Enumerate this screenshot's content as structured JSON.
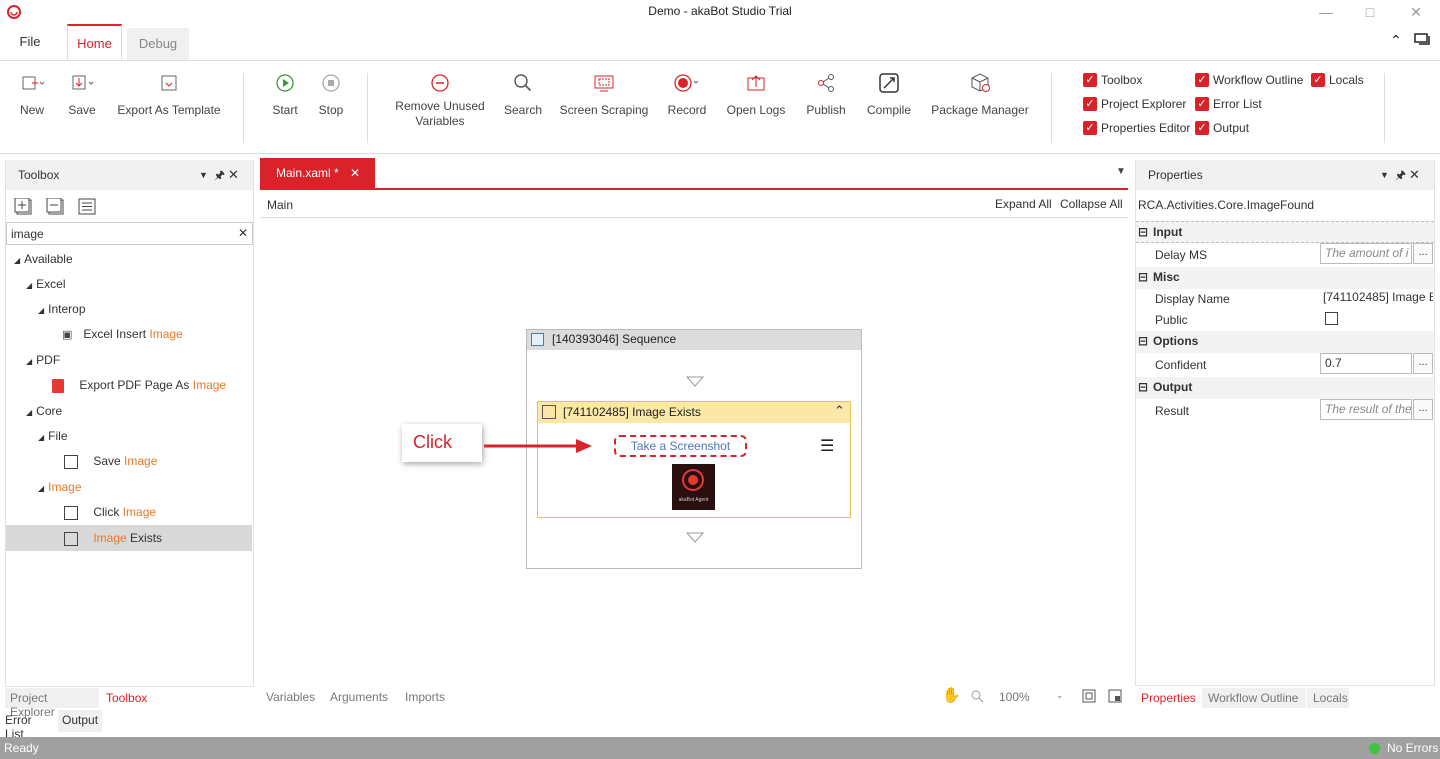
{
  "window": {
    "title": "Demo - akaBot Studio Trial"
  },
  "tabs": {
    "file": "File",
    "home": "Home",
    "debug": "Debug"
  },
  "ribbon": {
    "new": "New",
    "save": "Save",
    "export_template": "Export As Template",
    "start": "Start",
    "stop": "Stop",
    "remove_unused_1": "Remove Unused",
    "remove_unused_2": "Variables",
    "search": "Search",
    "screen_scraping": "Screen Scraping",
    "record": "Record",
    "open_logs": "Open Logs",
    "publish": "Publish",
    "compile": "Compile",
    "package_manager": "Package Manager"
  },
  "view_toggles": {
    "toolbox": "Toolbox",
    "workflow_outline": "Workflow Outline",
    "locals": "Locals",
    "project_explorer": "Project Explorer",
    "error_list": "Error List",
    "properties_editor": "Properties Editor",
    "output": "Output"
  },
  "toolbox": {
    "title": "Toolbox",
    "search_value": "image",
    "available": "Available",
    "excel": "Excel",
    "interop": "Interop",
    "excel_insert_pre": "Excel Insert ",
    "excel_insert_hl": "Image",
    "pdf": "PDF",
    "export_pdf_pre": "Export PDF Page As ",
    "export_pdf_hl": "Image",
    "core": "Core",
    "file": "File",
    "save_image_pre": "Save ",
    "save_image_hl": "Image",
    "image_group": "Image",
    "click_image_pre": "Click ",
    "click_image_hl": "Image",
    "image_exists_hl": "Image",
    "image_exists_post": " Exists"
  },
  "bottom_tabs_left": {
    "project_explorer": "Project Explorer",
    "toolbox": "Toolbox",
    "error_list": "Error List",
    "output": "Output"
  },
  "designer": {
    "tab_label": "Main.xaml *",
    "breadcrumb": "Main",
    "expand_all": "Expand All",
    "collapse_all": "Collapse All",
    "sequence_title": "[140393046] Sequence",
    "activity_title": "[741102485] Image Exists",
    "screenshot_link": "Take a Screenshot",
    "thumbnail_caption": "akaBot Agent",
    "callout": "Click",
    "variables": "Variables",
    "arguments": "Arguments",
    "imports": "Imports",
    "zoom": "100%"
  },
  "properties": {
    "title": "Properties",
    "type_name": "RCA.Activities.Core.ImageFound",
    "cat_input": "Input",
    "delay_ms": "Delay MS",
    "delay_placeholder": "The amount of i",
    "cat_misc": "Misc",
    "display_name": "Display Name",
    "display_name_value": "[741102485] Image E",
    "public": "Public",
    "cat_options": "Options",
    "confident": "Confident",
    "confident_value": "0.7",
    "cat_output": "Output",
    "result": "Result",
    "result_placeholder": "The result of the"
  },
  "bottom_tabs_right": {
    "properties": "Properties",
    "workflow_outline": "Workflow Outline",
    "locals": "Locals"
  },
  "status": {
    "ready": "Ready",
    "errors": "No Errors"
  },
  "colors": {
    "accent": "#d9222a",
    "highlight": "#e8792b",
    "activity_header": "#fbe7a8",
    "status_bar": "#a0a0a0"
  }
}
